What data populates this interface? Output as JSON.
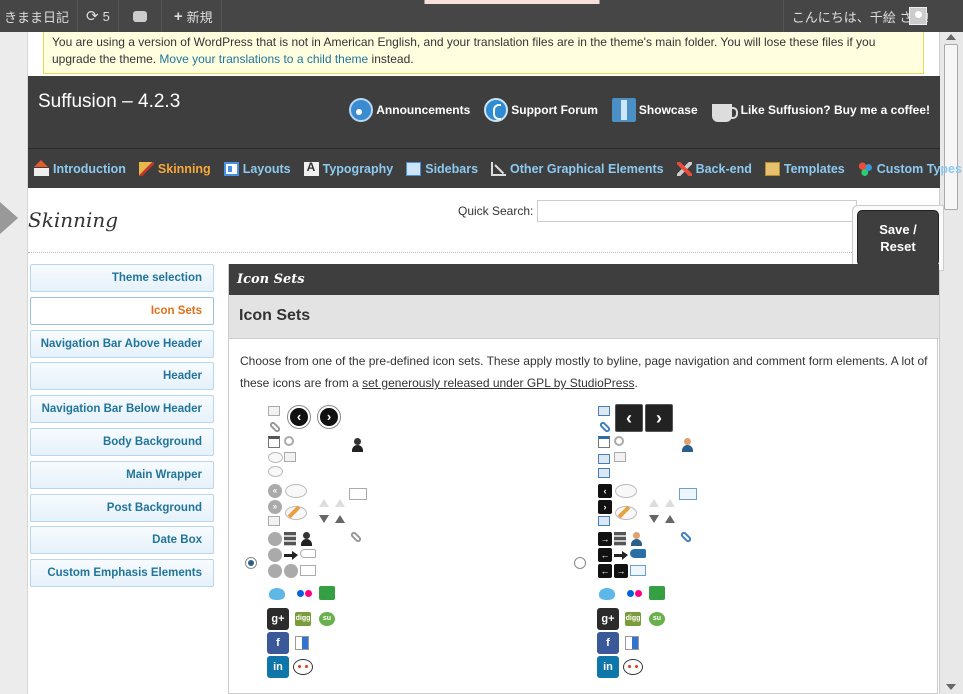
{
  "adminbar": {
    "site_name": "きまま日記",
    "updates_count": "5",
    "new_label": "新規",
    "greeting": "こんにちは、千絵 さん!"
  },
  "notice": {
    "text": "You are using a version of WordPress that is not in American English, and your translation files are in the theme's main folder. You will lose these files if you upgrade the theme.",
    "link": "Move your translations to a child theme",
    "tail": "instead."
  },
  "header": {
    "title": "Suffusion – 4.2.3",
    "links": [
      {
        "label": "Announcements",
        "icon": "rss-icon"
      },
      {
        "label": "Support Forum",
        "icon": "phone-icon"
      },
      {
        "label": "Showcase",
        "icon": "showcase-icon"
      },
      {
        "label": "Like Suffusion? Buy me a coffee!",
        "icon": "coffee-icon"
      }
    ]
  },
  "nav": {
    "items": [
      {
        "label": "Introduction",
        "icon": "house-icon"
      },
      {
        "label": "Skinning",
        "icon": "brush-icon",
        "active": true
      },
      {
        "label": "Layouts",
        "icon": "layout-icon"
      },
      {
        "label": "Typography",
        "icon": "typography-icon"
      },
      {
        "label": "Sidebars",
        "icon": "sidebar-icon"
      },
      {
        "label": "Other Graphical Elements",
        "icon": "graphics-icon"
      },
      {
        "label": "Back-end",
        "icon": "tools-icon"
      },
      {
        "label": "Templates",
        "icon": "template-icon"
      },
      {
        "label": "Custom Types",
        "icon": "custom-types-icon"
      }
    ],
    "active_color": "#f7a73a",
    "link_color": "#8ccaf0"
  },
  "page": {
    "title": "Skinning",
    "quick_search_label": "Quick Search:",
    "quick_search_value": "",
    "save_reset_line1": "Save /",
    "save_reset_line2": "Reset"
  },
  "sidebar": {
    "items": [
      {
        "label": "Theme selection"
      },
      {
        "label": "Icon Sets",
        "active": true
      },
      {
        "label": "Navigation Bar Above Header"
      },
      {
        "label": "Header"
      },
      {
        "label": "Navigation Bar Below Header"
      },
      {
        "label": "Body Background"
      },
      {
        "label": "Main Wrapper"
      },
      {
        "label": "Post Background"
      },
      {
        "label": "Date Box"
      },
      {
        "label": "Custom Emphasis Elements"
      }
    ]
  },
  "panel": {
    "bar_title": "Icon Sets",
    "heading": "Icon Sets",
    "description": "Choose from one of the pre-defined icon sets. These apply mostly to byline, page navigation and comment form elements. A lot of these icons are from a",
    "link": "set generously released under GPL by StudioPress",
    "period": ".",
    "selected_set": "first",
    "glyphs": {
      "prev": "‹",
      "next": "›",
      "left_arrow": "←",
      "right_arrow": "→",
      "rewind": "«",
      "forward": "»",
      "gplus": "g+",
      "digg": "digg",
      "stumble": "su",
      "facebook": "f",
      "linkedin": "in"
    }
  }
}
